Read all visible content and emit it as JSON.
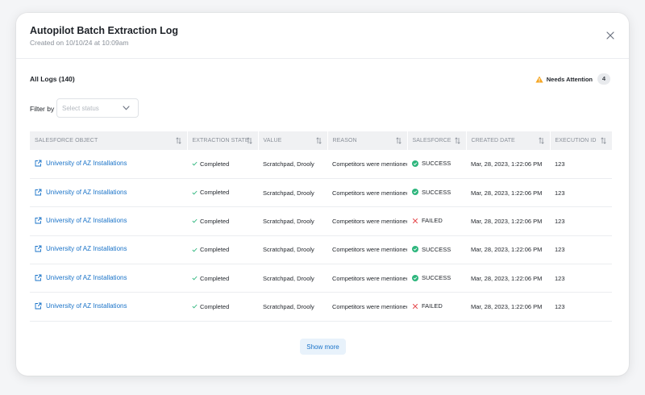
{
  "modal": {
    "title": "Autopilot Batch Extraction Log",
    "subtitle": "Created on 10/10/24 at 10:09am"
  },
  "logs": {
    "title": "All Logs (140)",
    "attention_label": "Needs Attention",
    "attention_count": "4"
  },
  "filter": {
    "label": "Filter by",
    "placeholder": "Select status"
  },
  "table": {
    "columns": [
      "SALESFORCE OBJECT",
      "EXTRACTION STATE",
      "VALUE",
      "REASON",
      "SALESFORCE",
      "CREATED DATE",
      "EXECUTION ID"
    ],
    "rows": [
      {
        "object": "University of AZ Installations",
        "state": "Completed",
        "value": "Scratchpad, Drooly",
        "reason": "Competitors were mentioned",
        "salesforce": "SUCCESS",
        "status": "success",
        "date": "Mar, 28, 2023, 1:22:06 PM",
        "execution_id": "123"
      },
      {
        "object": "University of AZ Installations",
        "state": "Completed",
        "value": "Scratchpad, Drooly",
        "reason": "Competitors were mentioned",
        "salesforce": "SUCCESS",
        "status": "success",
        "date": "Mar, 28, 2023, 1:22:06 PM",
        "execution_id": "123"
      },
      {
        "object": "University of AZ Installations",
        "state": "Completed",
        "value": "Scratchpad, Drooly",
        "reason": "Competitors were mentioned",
        "salesforce": "FAILED",
        "status": "failed",
        "date": "Mar, 28, 2023, 1:22:06 PM",
        "execution_id": "123"
      },
      {
        "object": "University of AZ Installations",
        "state": "Completed",
        "value": "Scratchpad, Drooly",
        "reason": "Competitors were mentioned",
        "salesforce": "SUCCESS",
        "status": "success",
        "date": "Mar, 28, 2023, 1:22:06 PM",
        "execution_id": "123"
      },
      {
        "object": "University of AZ Installations",
        "state": "Completed",
        "value": "Scratchpad, Drooly",
        "reason": "Competitors were mentioned",
        "salesforce": "SUCCESS",
        "status": "success",
        "date": "Mar, 28, 2023, 1:22:06 PM",
        "execution_id": "123"
      },
      {
        "object": "University of AZ Installations",
        "state": "Completed",
        "value": "Scratchpad, Drooly",
        "reason": "Competitors were mentioned",
        "salesforce": "FAILED",
        "status": "failed",
        "date": "Mar, 28, 2023, 1:22:06 PM",
        "execution_id": "123"
      }
    ]
  },
  "show_more_label": "Show more",
  "colors": {
    "link": "#1a73c8",
    "success": "#2eb67d",
    "failed": "#e5484d",
    "completed_check": "#2eb67d",
    "warning": "#f5a623"
  },
  "icons": {
    "close": "close-icon",
    "warning": "warning-icon",
    "chevron": "chevron-down-icon",
    "sort": "sort-icon",
    "external_link": "external-link-icon",
    "check": "check-icon",
    "success": "success-circle-icon",
    "failed": "x-icon"
  }
}
